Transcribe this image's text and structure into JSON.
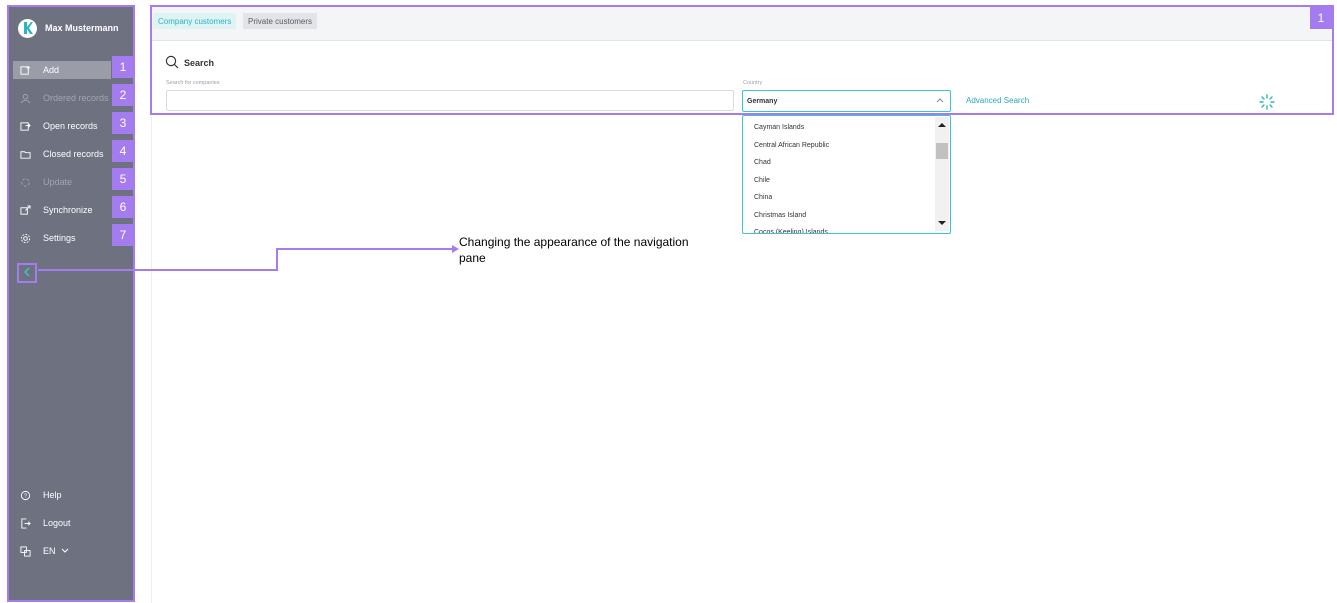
{
  "sidebar": {
    "user_name": "Max Mustermann",
    "items": [
      {
        "label": "Add",
        "icon": "add-record-icon",
        "badge": "1"
      },
      {
        "label": "Ordered records",
        "icon": "ordered-records-icon",
        "badge": "2"
      },
      {
        "label": "Open records",
        "icon": "open-records-icon",
        "badge": "3"
      },
      {
        "label": "Closed records",
        "icon": "closed-records-icon",
        "badge": "4"
      },
      {
        "label": "Update",
        "icon": "update-icon",
        "badge": "5"
      },
      {
        "label": "Synchronize",
        "icon": "synchronize-icon",
        "badge": "6"
      },
      {
        "label": "Settings",
        "icon": "settings-icon",
        "badge": "7"
      }
    ],
    "bottom": [
      {
        "label": "Help",
        "icon": "help-icon"
      },
      {
        "label": "Logout",
        "icon": "logout-icon"
      },
      {
        "label": "EN",
        "icon": "language-icon"
      }
    ]
  },
  "tabs": {
    "company": "Company customers",
    "private": "Private customers"
  },
  "main": {
    "badge": "1",
    "search_title": "Search",
    "search_label": "Search for companies",
    "search_value": "",
    "country_label": "Country",
    "country_value": "Germany",
    "advanced_search": "Advanced Search"
  },
  "dropdown": {
    "options": [
      "Cayman Islands",
      "Central African Republic",
      "Chad",
      "Chile",
      "China",
      "Christmas Island",
      "Cocos (Keeling) Islands"
    ]
  },
  "callout": {
    "text": "Changing the appearance of the navigation pane"
  },
  "colors": {
    "accent": "#3cc3cf",
    "annotation": "#a57bf0",
    "sidebar": "#6e7180"
  }
}
